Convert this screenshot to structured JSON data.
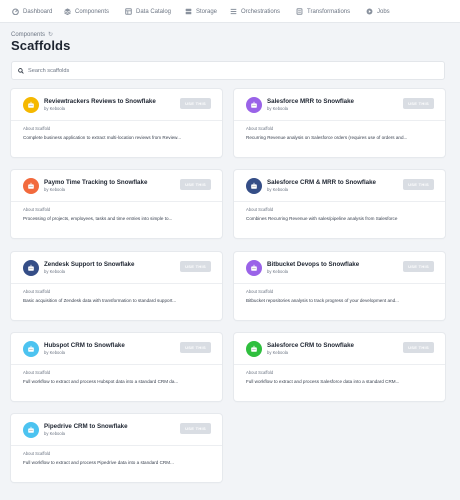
{
  "nav": {
    "items": [
      {
        "label": "Dashboard",
        "icon": "dashboard-icon"
      },
      {
        "label": "Components",
        "icon": "components-icon"
      },
      {
        "label": "Data Catalog",
        "icon": "data-catalog-icon"
      },
      {
        "label": "Storage",
        "icon": "storage-icon"
      },
      {
        "label": "Orchestrations",
        "icon": "orchestrations-icon"
      },
      {
        "label": "Transformations",
        "icon": "transformations-icon"
      },
      {
        "label": "Jobs",
        "icon": "jobs-icon"
      }
    ]
  },
  "breadcrumb": {
    "label": "Components",
    "icon": "refresh-icon"
  },
  "page_title": "Scaffolds",
  "search": {
    "placeholder": "Search scaffolds",
    "value": ""
  },
  "about_label": "About Scaffold",
  "use_label": "USE THIS",
  "scaffolds": [
    {
      "title": "Reviewtrackers Reviews to Snowflake",
      "author": "by Keboola",
      "description": "Complete business application to extract multi-location reviews from Review...",
      "logo_color": "#f5b800"
    },
    {
      "title": "Salesforce MRR to Snowflake",
      "author": "by Keboola",
      "description": "Recurring Revenue analysis on Salesforce orders (requires use of orders and...",
      "logo_color": "#9a63e8"
    },
    {
      "title": "Paymo Time Tracking to Snowflake",
      "author": "by Keboola",
      "description": "Processing of projects, employees, tasks and time entries into simple to...",
      "logo_color": "#f26a3d"
    },
    {
      "title": "Salesforce CRM & MRR to Snowflake",
      "author": "by Keboola",
      "description": "Combines Recurring Revenue with sales/pipeline analysis from Salesforce",
      "logo_color": "#354e87"
    },
    {
      "title": "Zendesk Support to Snowflake",
      "author": "by Keboola",
      "description": "Basic acquisition of Zendesk data with transformation to standard support...",
      "logo_color": "#354e87"
    },
    {
      "title": "Bitbucket Devops to Snowflake",
      "author": "by Keboola",
      "description": "Bitbucket repositories analysis to track progress of your development and...",
      "logo_color": "#9a63e8"
    },
    {
      "title": "Hubspot CRM to Snowflake",
      "author": "by Keboola",
      "description": "Full workflow to extract and process Hubspot data into a standard CRM da...",
      "logo_color": "#4cc3f0"
    },
    {
      "title": "Salesforce CRM to Snowflake",
      "author": "by Keboola",
      "description": "Full workflow to extract and process Salesforce data into a standard CRM...",
      "logo_color": "#2fbf3e"
    },
    {
      "title": "Pipedrive CRM to Snowflake",
      "author": "by Keboola",
      "description": "Full workflow to extract and process Pipedrive data into a standard CRM...",
      "logo_color": "#4cc3f0"
    }
  ]
}
